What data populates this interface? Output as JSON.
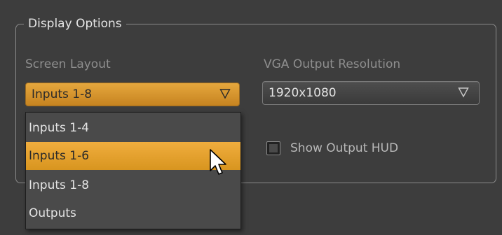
{
  "display_options": {
    "title": "Display Options",
    "screen_layout": {
      "label": "Screen Layout",
      "selected": "Inputs 1-8",
      "options": [
        "Inputs 1-4",
        "Inputs 1-6",
        "Inputs 1-8",
        "Outputs"
      ],
      "highlighted": "Inputs 1-6"
    },
    "vga_output": {
      "label": "VGA Output Resolution",
      "selected": "1920x1080"
    },
    "show_output_hud": {
      "label": "Show Output HUD",
      "checked": false
    }
  },
  "colors": {
    "accent": "#e09a2e",
    "background": "#3d3d3d"
  }
}
